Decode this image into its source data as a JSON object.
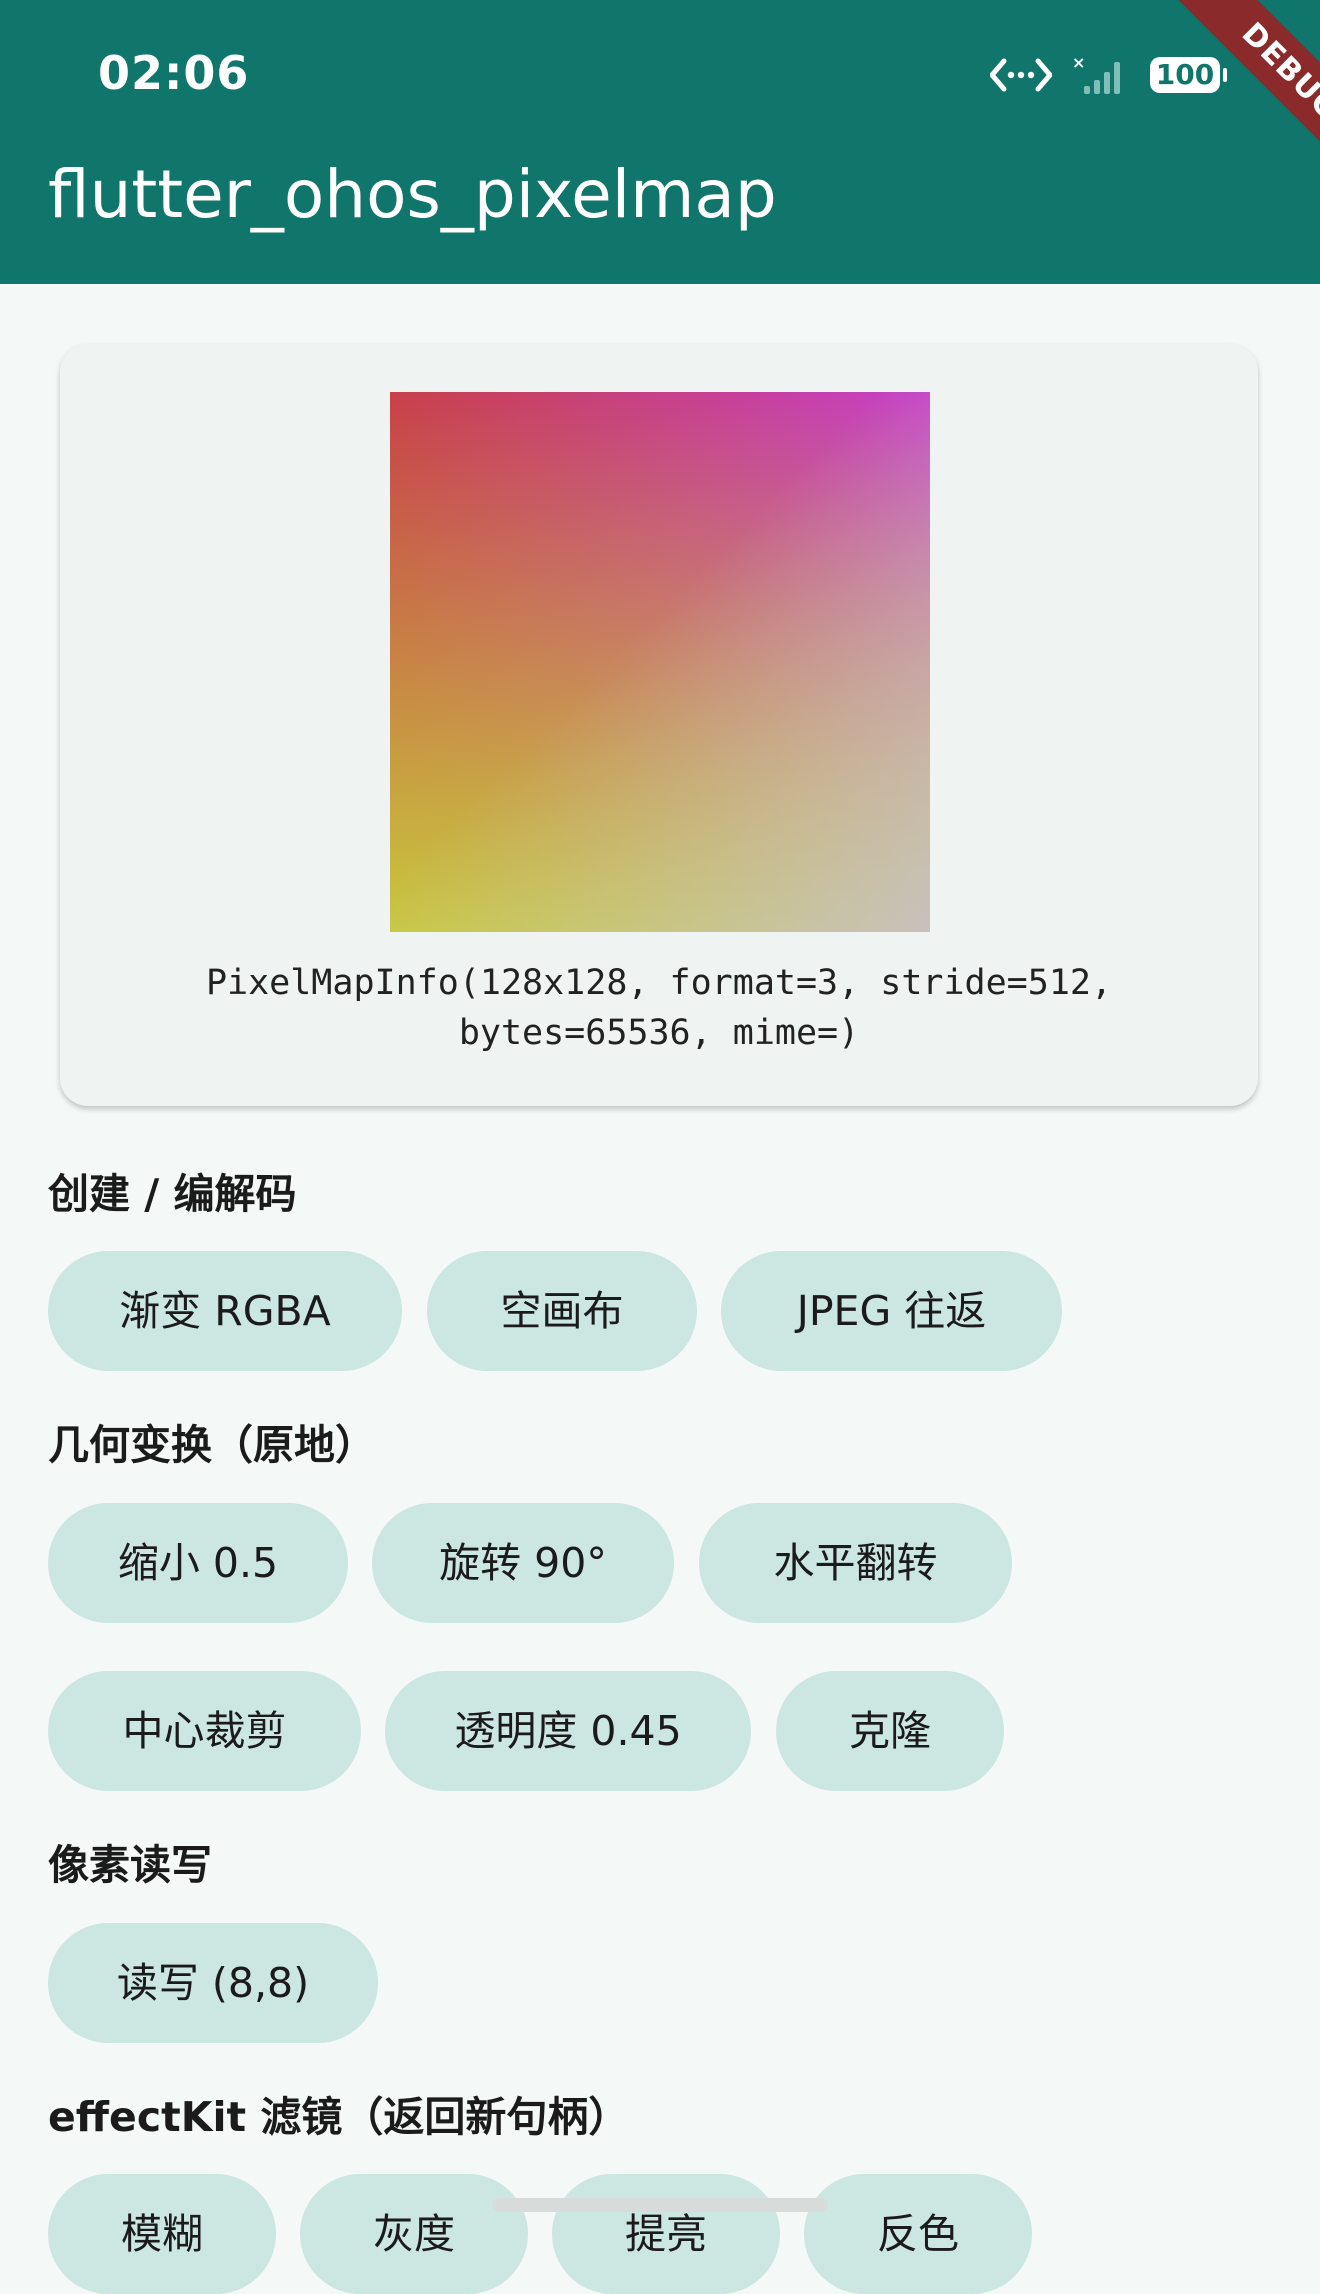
{
  "status_bar": {
    "time": "02:06",
    "battery": "100",
    "icons": [
      "data-transfer-icon",
      "signal-icon",
      "battery-icon"
    ]
  },
  "debug_banner": "DEBUG",
  "app_bar": {
    "title": "flutter_ohos_pixelmap",
    "color": "#10766c"
  },
  "preview": {
    "info_line1": "PixelMapInfo(128x128, format=3, stride=512,",
    "info_line2": "bytes=65536, mime=)"
  },
  "sections": {
    "create": {
      "title": "创建 / 编解码",
      "buttons": [
        "渐变 RGBA",
        "空画布",
        "JPEG 往返"
      ]
    },
    "transform": {
      "title": "几何变换（原地）",
      "buttons": [
        "缩小 0.5",
        "旋转 90°",
        "水平翻转",
        "中心裁剪",
        "透明度 0.45",
        "克隆"
      ]
    },
    "pixels": {
      "title": "像素读写",
      "buttons": [
        "读写 (8,8)"
      ]
    },
    "effect": {
      "title": "effectKit 滤镜（返回新句柄）",
      "buttons": [
        "模糊",
        "灰度",
        "提亮",
        "反色"
      ]
    }
  },
  "colors": {
    "primary": "#10766c",
    "chip_bg": "#cce6e2",
    "page_bg": "#f4f9f8",
    "card_bg": "#eff4f3"
  }
}
